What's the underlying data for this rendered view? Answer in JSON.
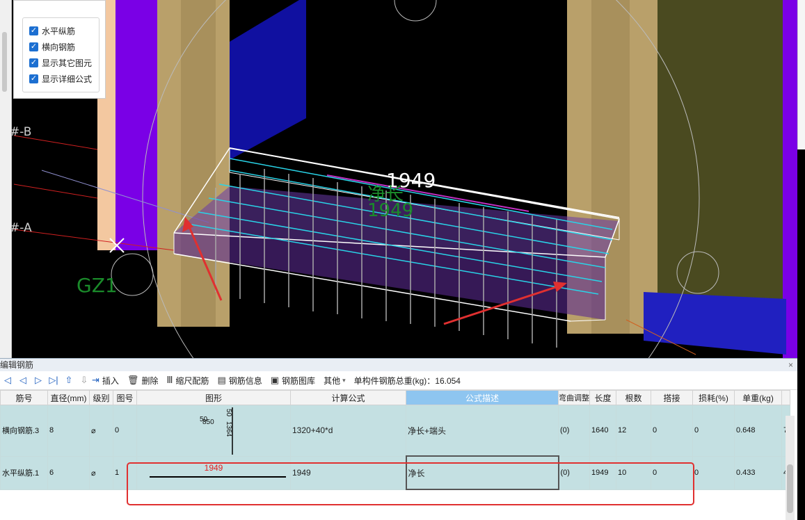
{
  "viewport": {
    "axis_labels": [
      "#-B",
      "#-A"
    ],
    "dimension_top": "1949",
    "dimension_desc": "净长",
    "dimension_bottom": "1949"
  },
  "check_panel": {
    "items": [
      {
        "label": "水平纵筋",
        "checked": true
      },
      {
        "label": "横向钢筋",
        "checked": true
      },
      {
        "label": "显示其它图元",
        "checked": true
      },
      {
        "label": "显示详细公式",
        "checked": true
      }
    ]
  },
  "panel": {
    "title": "编辑钢筋",
    "close": "×",
    "toolbar": {
      "insert": "插入",
      "delete": "删除",
      "scale_rebar": "缩尺配筋",
      "rebar_info": "钢筋信息",
      "rebar_library": "钢筋图库",
      "other": "其他",
      "total_weight": "单构件钢筋总重(kg)：16.054"
    },
    "columns": [
      "筋号",
      "直径(mm)",
      "级别",
      "图号",
      "图形",
      "计算公式",
      "公式描述",
      "弯曲调整",
      "长度",
      "根数",
      "搭接",
      "损耗(%)",
      "单重(kg)"
    ],
    "rows": [
      {
        "name": "横向钢筋.3",
        "diameter": "8",
        "grade": "⌀",
        "fig": "0",
        "shape_nums": [
          "50",
          "850",
          "1364",
          "50"
        ],
        "formula": "1320+40*d",
        "desc": "净长+端头",
        "bend": "(0)",
        "length": "1640",
        "count": "12",
        "lap": "0",
        "loss": "0",
        "unit_weight": "0.648",
        "extra": "7"
      },
      {
        "name": "水平纵筋.1",
        "diameter": "6",
        "grade": "⌀",
        "fig": "1",
        "shape_value": "1949",
        "formula": "1949",
        "desc": "净长",
        "bend": "(0)",
        "length": "1949",
        "count": "10",
        "lap": "0",
        "loss": "0",
        "unit_weight": "0.433",
        "extra": "4"
      }
    ]
  },
  "colors": {
    "purple": "#7a00e6",
    "wall_tan": "#b9a06a",
    "active_header": "#8ec5f0",
    "row_bg": "#c4e0e2",
    "annotation_red": "#e03030",
    "checkbox_blue": "#1c6fd1"
  }
}
